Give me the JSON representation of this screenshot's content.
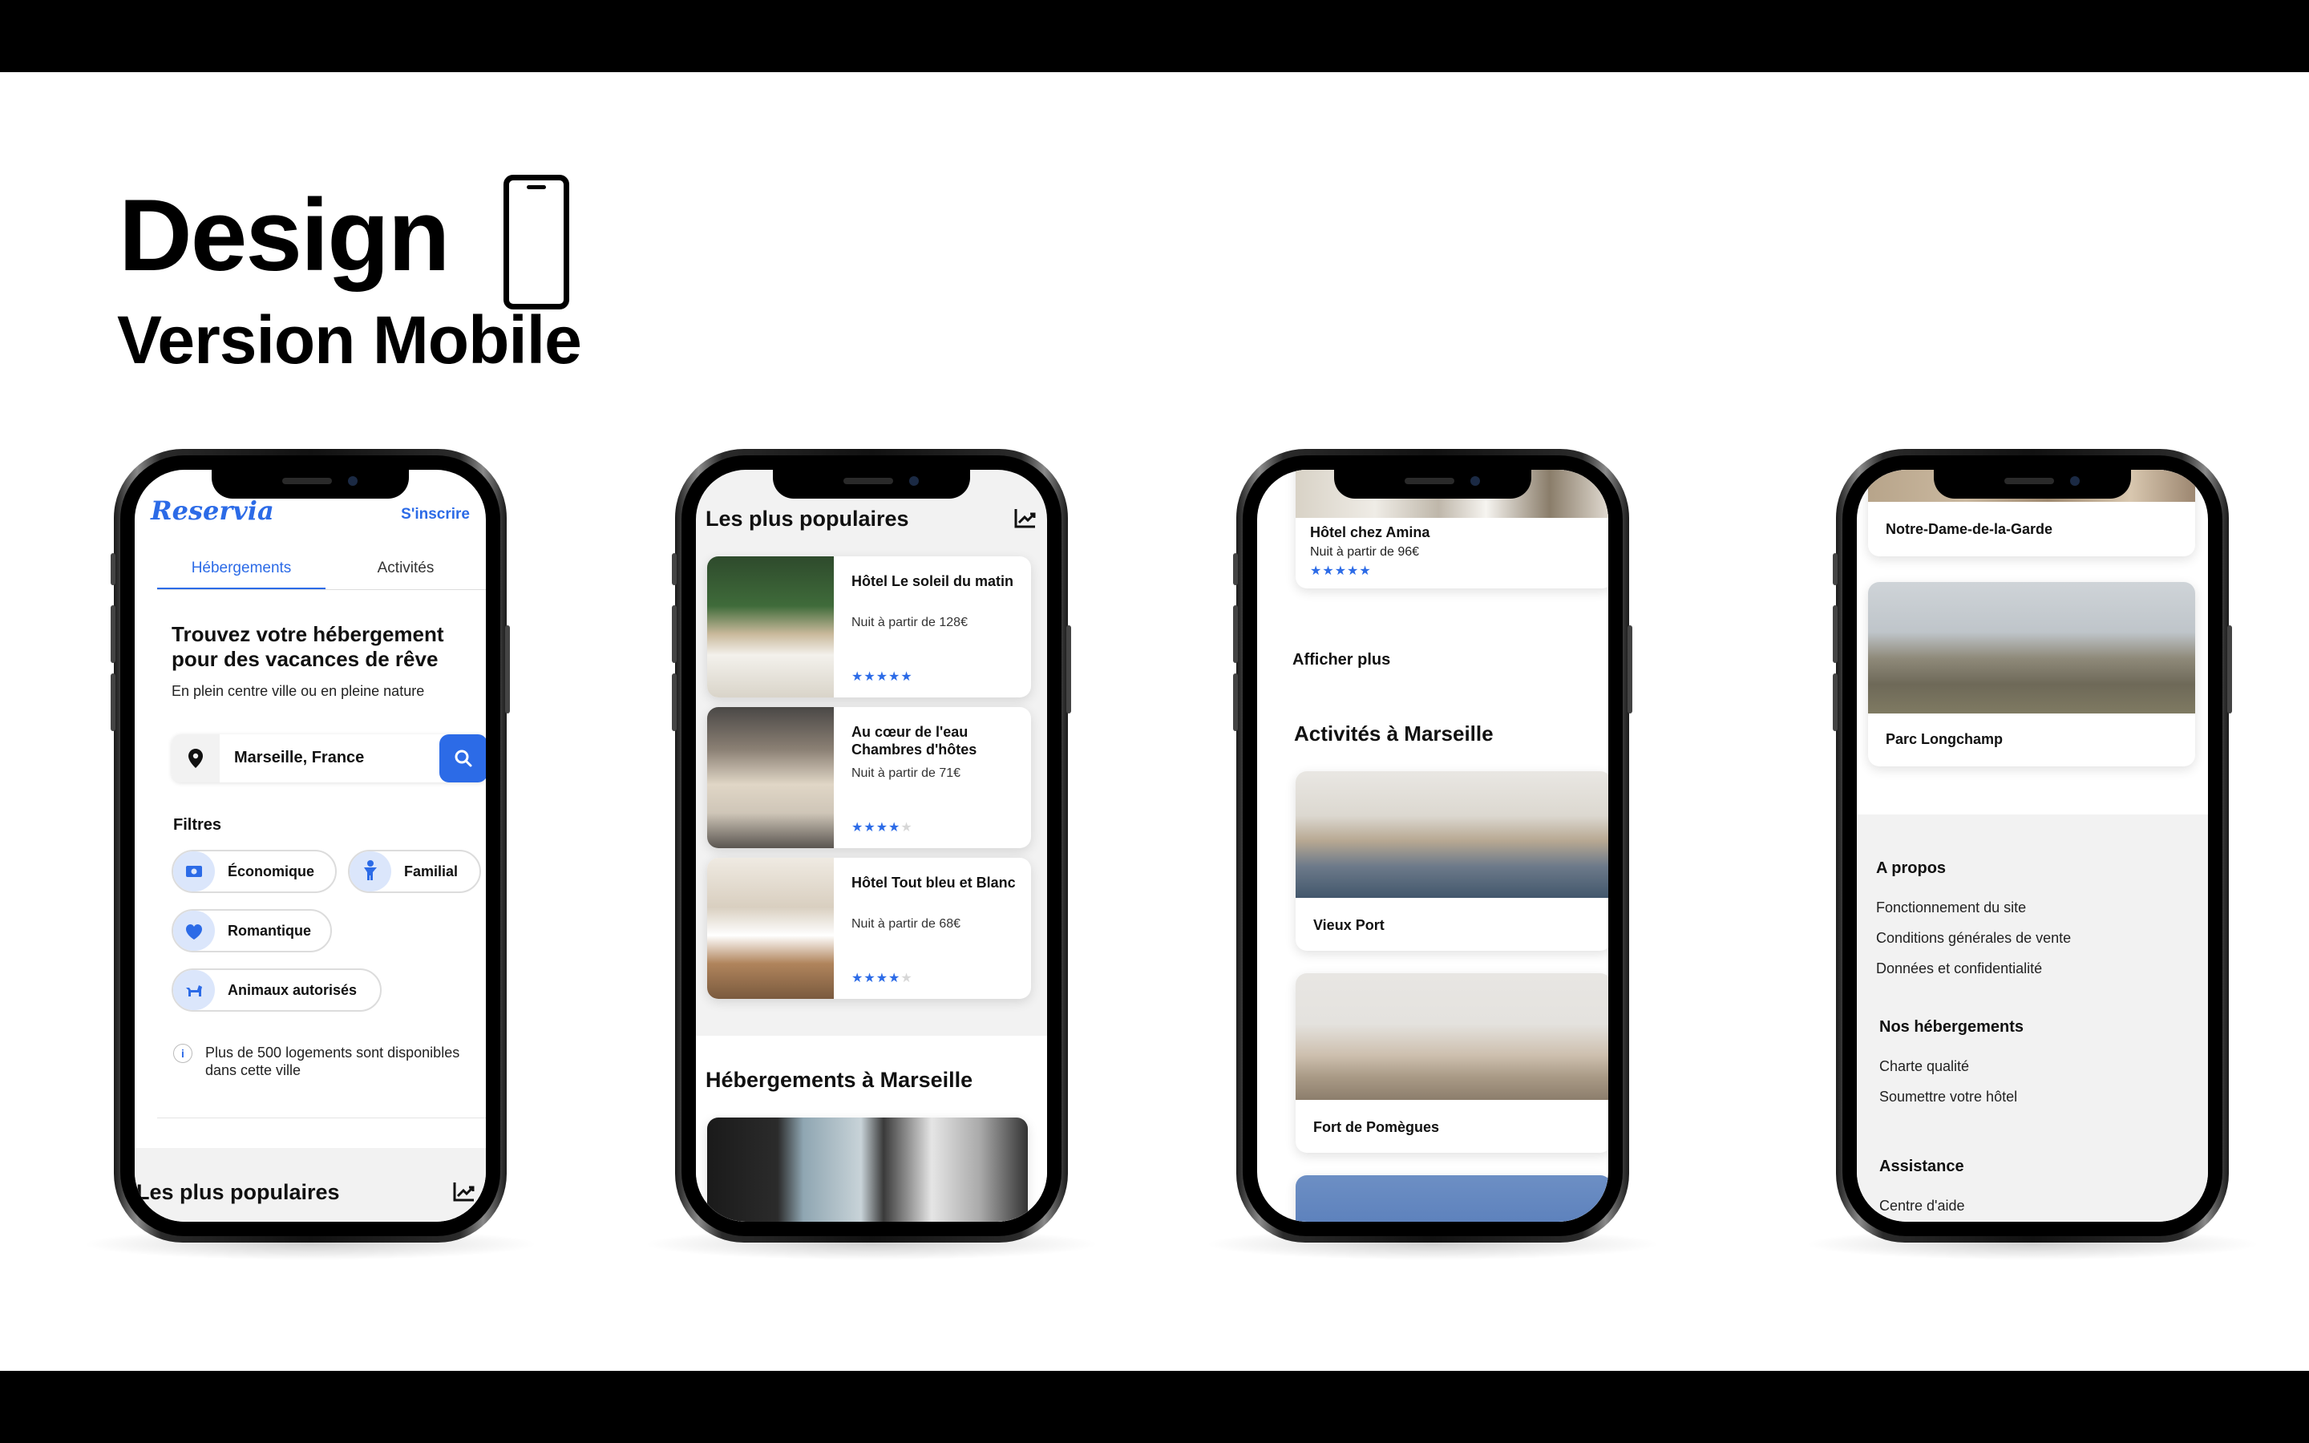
{
  "header": {
    "title": "Design",
    "subtitle": "Version Mobile",
    "icon": "smartphone-icon"
  },
  "colors": {
    "accent": "#2c6be7",
    "pill_icon_bg": "#dbe6fb",
    "light_section": "#f2f2f2"
  },
  "screen1": {
    "logo": "Reservia",
    "signup": "S'inscrire",
    "tabs": [
      "Hébergements",
      "Activités"
    ],
    "hero_title": "Trouvez votre hébergement pour des vacances de rêve",
    "hero_sub": "En plein centre ville ou en pleine nature",
    "search_value": "Marseille, France",
    "filters_title": "Filtres",
    "filters": [
      "Économique",
      "Familial",
      "Romantique",
      "Animaux autorisés"
    ],
    "info": "Plus de 500 logements sont disponibles dans cette ville",
    "popular_title": "Les plus populaires"
  },
  "screen2": {
    "popular_title": "Les plus populaires",
    "hotels": [
      {
        "name": "Hôtel Le soleil du matin",
        "price": "Nuit à partir de 128€",
        "rating": 5
      },
      {
        "name": "Au cœur de l'eau Chambres d'hôtes",
        "price": "Nuit à partir de 71€",
        "rating": 4
      },
      {
        "name": "Hôtel Tout bleu et Blanc",
        "price": "Nuit à partir de 68€",
        "rating": 4
      }
    ],
    "section_title": "Hébergements à Marseille"
  },
  "screen3": {
    "hotel_name": "Hôtel chez Amina",
    "hotel_price": "Nuit à partir de 96€",
    "hotel_rating": 5,
    "more": "Afficher plus",
    "activities_title": "Activités à Marseille",
    "activities": [
      "Vieux Port",
      "Fort de Pomègues"
    ]
  },
  "screen4": {
    "activities": [
      "Notre-Dame-de-la-Garde",
      "Parc Longchamp"
    ],
    "footer": [
      {
        "title": "A propos",
        "links": [
          "Fonctionnement du site",
          "Conditions générales de vente",
          "Données et confidentialité"
        ]
      },
      {
        "title": "Nos hébergements",
        "links": [
          "Charte qualité",
          "Soumettre votre hôtel"
        ]
      },
      {
        "title": "Assistance",
        "links": [
          "Centre d'aide"
        ]
      }
    ]
  }
}
